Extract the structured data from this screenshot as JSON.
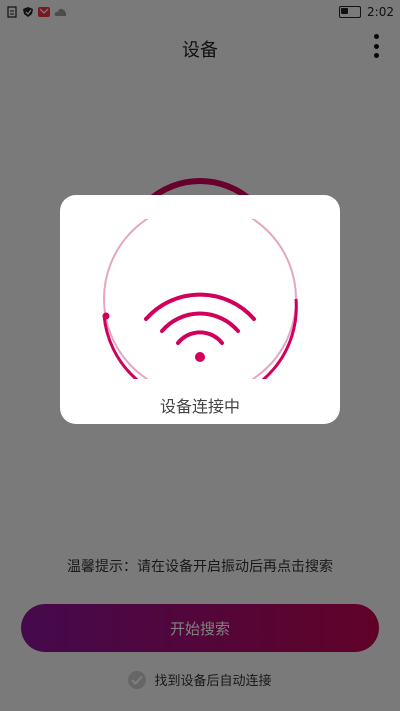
{
  "statusbar": {
    "time": "2:02",
    "icons": [
      "document-icon",
      "shield-icon",
      "mail-icon",
      "cloud-icon"
    ],
    "battery_icon": "battery-icon"
  },
  "header": {
    "title": "设备",
    "more_icon": "more-vert-icon"
  },
  "main": {
    "hint": "温馨提示：请在设备开启振动后再点击搜索",
    "start_button": "开始搜索",
    "auto_connect_label": "找到设备后自动连接",
    "auto_connect_checked": true
  },
  "dialog": {
    "message": "设备连接中",
    "icon": "wifi-icon"
  },
  "colors": {
    "accent": "#d0005b",
    "gradient_start": "#8a1399",
    "gradient_end": "#c2054f",
    "overlay": "#000000"
  }
}
